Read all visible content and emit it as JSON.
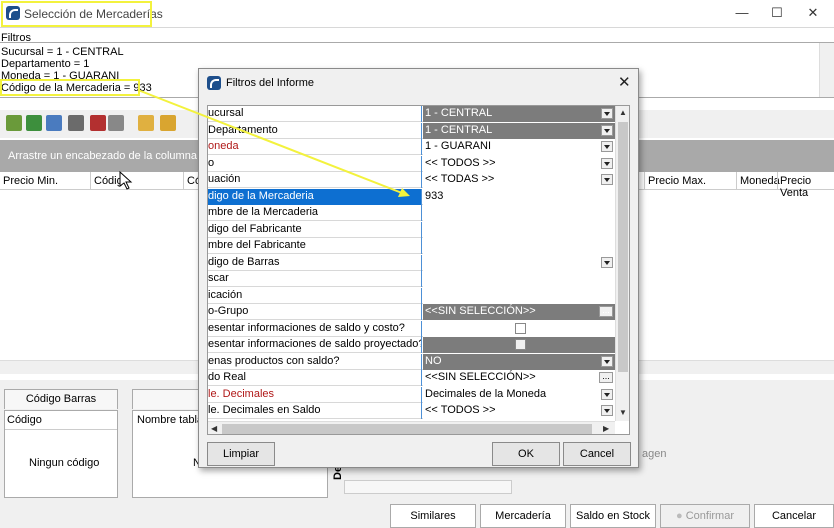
{
  "window": {
    "title": "Selección de Mercaderías",
    "min": "—",
    "max": "☐",
    "close": "✕"
  },
  "filters": {
    "label": "Filtros",
    "lines": [
      "Sucursal = 1 - CENTRAL",
      "Departamento = 1",
      "Moneda = 1 - GUARANI",
      "Código de la Mercaderia = 933"
    ]
  },
  "grid": {
    "group_hint": "Arrastre un encabezado de la columna aqu",
    "columns_left": [
      "Precio Min.",
      "Códig",
      "Có"
    ],
    "columns_right": [
      "Precio Max.",
      "Moneda",
      "Precio Venta"
    ]
  },
  "bottom": {
    "tab1": "Código Barras",
    "tab2": "T",
    "panel1_header": "Código",
    "panel1_empty": "Ningun código",
    "panel2_header": "Nombre tabla",
    "panel2_cut": "N",
    "image_hint": "agen",
    "desc_label": "Des",
    "buttons": [
      "Similares",
      "Mercadería",
      "Saldo en Stock",
      "Confirmar",
      "Cancelar"
    ]
  },
  "dialog": {
    "title": "Filtros del Informe",
    "close": "✕",
    "rows": [
      {
        "label": "ucursal",
        "value": "1 - CENTRAL",
        "style": "dark",
        "ctrl": "dd"
      },
      {
        "label": "Departamento",
        "value": "1 - CENTRAL",
        "style": "dark",
        "ctrl": "dd"
      },
      {
        "label": "oneda",
        "value": "1 - GUARANI",
        "style": "plain",
        "ctrl": "dd",
        "red": true
      },
      {
        "label": "o",
        "value": "<< TODOS >>",
        "style": "plain",
        "ctrl": "dd"
      },
      {
        "label": "uación",
        "value": "<< TODAS >>",
        "style": "plain",
        "ctrl": "dd"
      },
      {
        "label": "digo de la Mercaderia",
        "value": "933",
        "style": "plain",
        "ctrl": "",
        "sel": true
      },
      {
        "label": "mbre de la Mercaderia",
        "value": "",
        "style": "plain",
        "ctrl": ""
      },
      {
        "label": "digo del Fabricante",
        "value": "",
        "style": "plain",
        "ctrl": ""
      },
      {
        "label": "mbre del Fabricante",
        "value": "",
        "style": "plain",
        "ctrl": ""
      },
      {
        "label": "digo de Barras",
        "value": "",
        "style": "plain",
        "ctrl": "dd"
      },
      {
        "label": "scar",
        "value": "",
        "style": "plain",
        "ctrl": ""
      },
      {
        "label": "icación",
        "value": "",
        "style": "plain",
        "ctrl": ""
      },
      {
        "label": "o-Grupo",
        "value": "<<SIN SELECCIÓN>>",
        "style": "dark",
        "ctrl": "ell"
      },
      {
        "label": "esentar informaciones de saldo y costo?",
        "value": "",
        "style": "plain",
        "ctrl": "chk"
      },
      {
        "label": "esentar informaciones de saldo proyectado?",
        "value": "",
        "style": "dark",
        "ctrl": "chkg"
      },
      {
        "label": "enas productos con saldo?",
        "value": "NO",
        "style": "dark",
        "ctrl": "dd"
      },
      {
        "label": "do Real",
        "value": "<<SIN SELECCIÓN>>",
        "style": "plain",
        "ctrl": "ell"
      },
      {
        "label": "le. Decimales",
        "value": "Decimales de la Moneda",
        "style": "plain",
        "ctrl": "dd",
        "red": true
      },
      {
        "label": "le. Decimales en Saldo",
        "value": "<< TODOS >>",
        "style": "plain",
        "ctrl": "dd"
      }
    ],
    "buttons": {
      "limpiar": "Limpiar",
      "ok": "OK",
      "cancel": "Cancel"
    }
  },
  "colors": {
    "accent": "#0d6fd1",
    "highlight": "#f3f23d",
    "dark_cell": "#7c7c7c"
  }
}
